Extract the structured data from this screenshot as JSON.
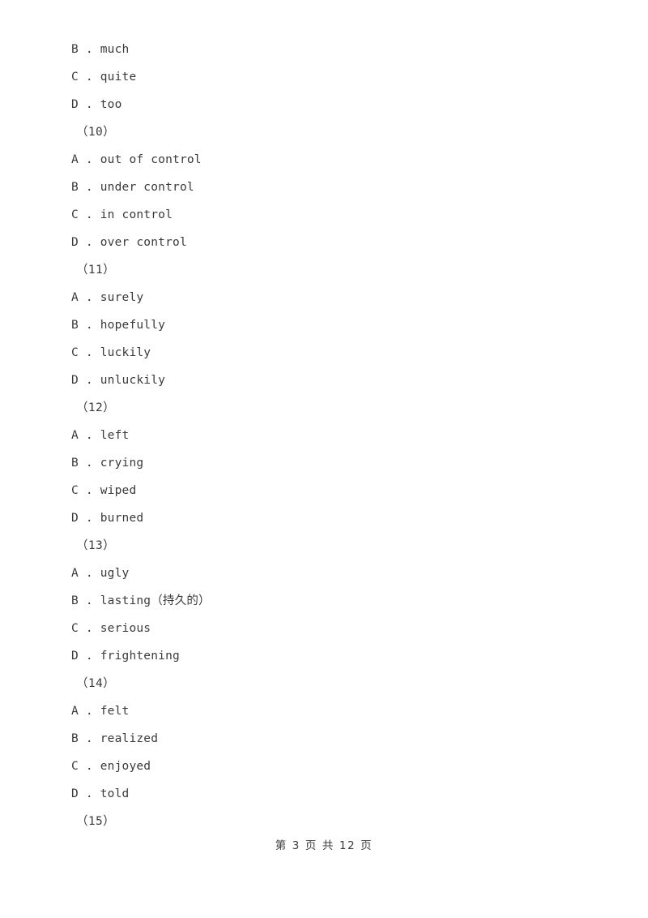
{
  "document": {
    "page_footer": "第 3 页 共 12 页",
    "page_current": "3",
    "page_total": "12"
  },
  "lines": [
    {
      "kind": "option",
      "text": "B . much"
    },
    {
      "kind": "option",
      "text": "C . quite"
    },
    {
      "kind": "option",
      "text": "D . too"
    },
    {
      "kind": "question",
      "text": "（10）"
    },
    {
      "kind": "option",
      "text": "A . out of control"
    },
    {
      "kind": "option",
      "text": "B . under control"
    },
    {
      "kind": "option",
      "text": "C . in control"
    },
    {
      "kind": "option",
      "text": "D . over control"
    },
    {
      "kind": "question",
      "text": "（11）"
    },
    {
      "kind": "option",
      "text": "A . surely"
    },
    {
      "kind": "option",
      "text": "B . hopefully"
    },
    {
      "kind": "option",
      "text": "C . luckily"
    },
    {
      "kind": "option",
      "text": "D . unluckily"
    },
    {
      "kind": "question",
      "text": "（12）"
    },
    {
      "kind": "option",
      "text": "A . left"
    },
    {
      "kind": "option",
      "text": "B . crying"
    },
    {
      "kind": "option",
      "text": "C . wiped"
    },
    {
      "kind": "option",
      "text": "D . burned"
    },
    {
      "kind": "question",
      "text": "（13）"
    },
    {
      "kind": "option",
      "text": "A . ugly"
    },
    {
      "kind": "option-cjk",
      "text": "B . lasting（持久的）"
    },
    {
      "kind": "option",
      "text": "C . serious"
    },
    {
      "kind": "option",
      "text": "D . frightening"
    },
    {
      "kind": "question",
      "text": "（14）"
    },
    {
      "kind": "option",
      "text": "A . felt"
    },
    {
      "kind": "option",
      "text": "B . realized"
    },
    {
      "kind": "option",
      "text": "C . enjoyed"
    },
    {
      "kind": "option",
      "text": "D . told"
    },
    {
      "kind": "question",
      "text": "（15）"
    }
  ],
  "colors": {
    "page_background": "#ffffff",
    "text": "#3a3a3a"
  }
}
